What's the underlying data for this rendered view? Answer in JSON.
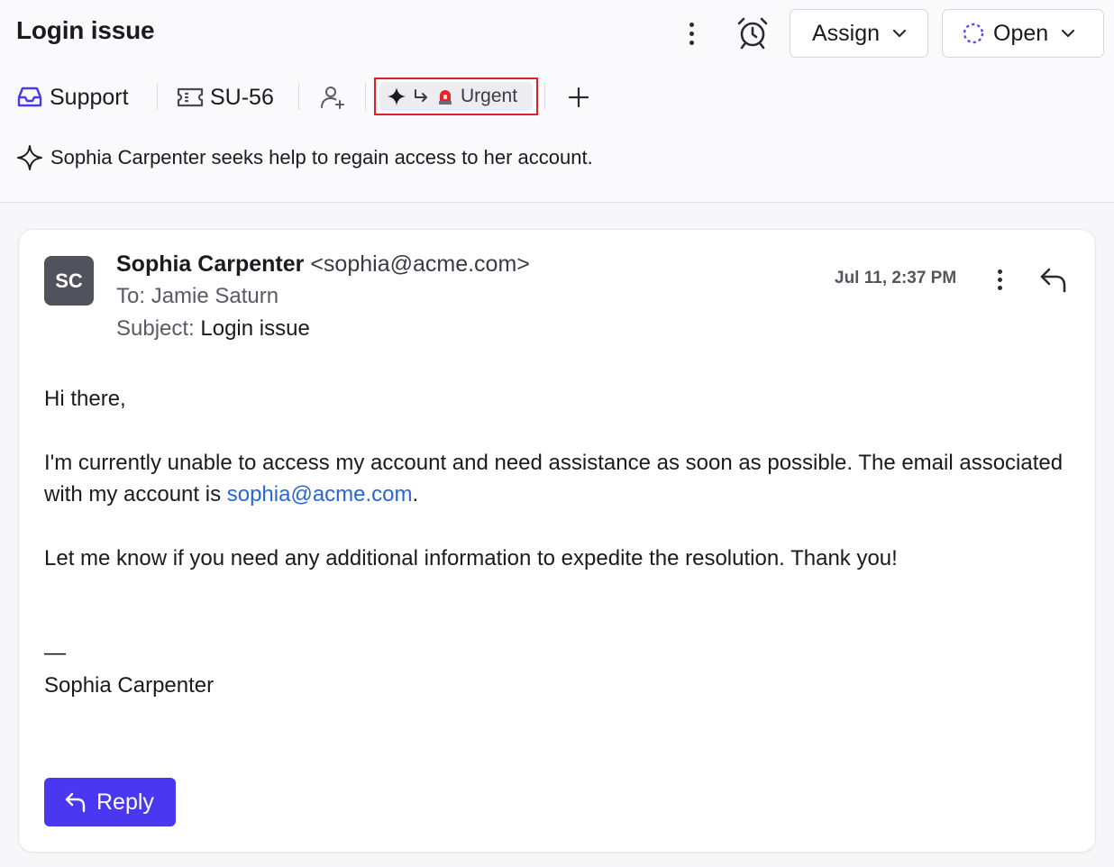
{
  "header": {
    "title": "Login issue",
    "assign_label": "Assign",
    "status_label": "Open"
  },
  "tags": {
    "team": "Support",
    "ticket_id": "SU-56",
    "priority": "Urgent"
  },
  "summary": "Sophia Carpenter seeks help to regain access to her account.",
  "message": {
    "avatar_initials": "SC",
    "sender_name": "Sophia Carpenter",
    "sender_email": "<sophia@acme.com>",
    "to_label": "To:",
    "to_value": "Jamie Saturn",
    "subject_label": "Subject:",
    "subject_value": "Login issue",
    "date": "Jul 11, 2:37 PM",
    "greeting": "Hi there,",
    "para1_before": "I'm currently unable to access my account and need assistance as soon as possible. The email associated with my account is ",
    "para1_link": "sophia@acme.com",
    "para1_after": ".",
    "para2": "Let me know if you need any additional information to expedite the resolution. Thank you!",
    "sig_dash": "—",
    "signature": "Sophia Carpenter"
  },
  "reply_button": "Reply",
  "colors": {
    "accent": "#4a37f0",
    "link": "#2966d8",
    "highlight_border": "#e01f26",
    "inbox_icon": "#4a37f0",
    "status_ring": "#6b46e8"
  }
}
